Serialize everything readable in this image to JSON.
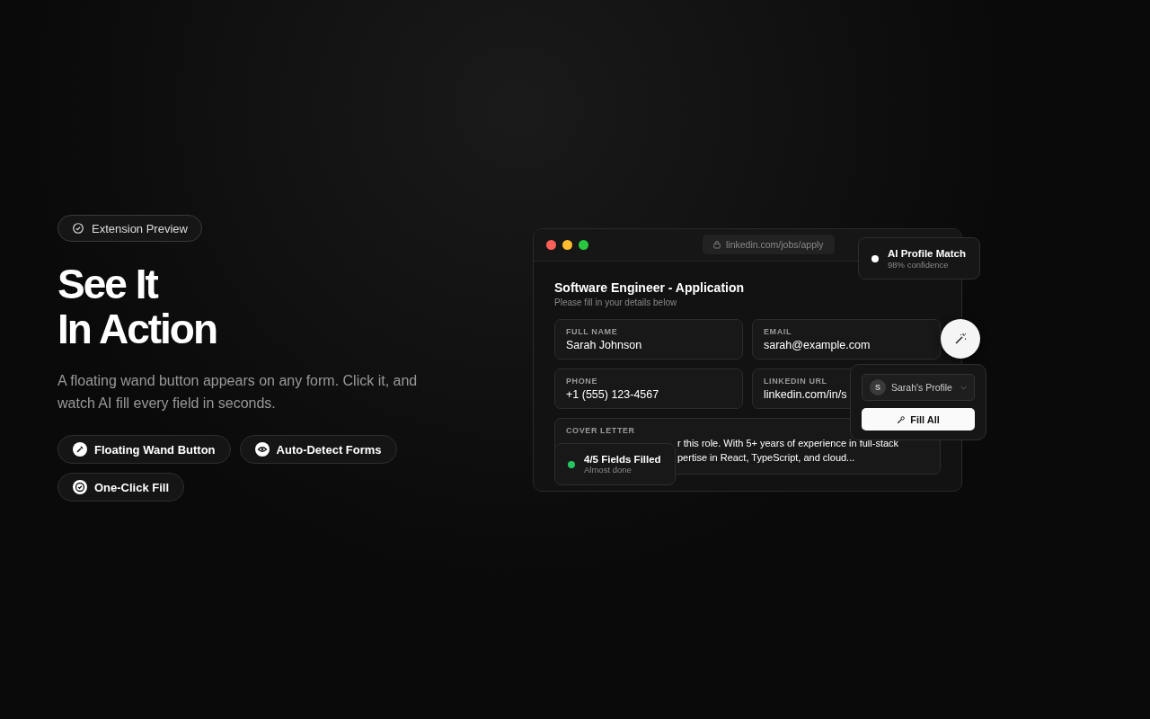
{
  "badge": {
    "label": "Extension Preview"
  },
  "heading": [
    "See It",
    "In Action"
  ],
  "description": "A floating wand button appears on any form. Click it, and watch AI fill every field in seconds.",
  "features": [
    {
      "kind": "wand",
      "label": "Floating Wand Button"
    },
    {
      "kind": "eye",
      "label": "Auto-Detect Forms"
    },
    {
      "kind": "check",
      "label": "One-Click Fill"
    }
  ],
  "browser": {
    "url": "linkedin.com/jobs/apply",
    "form_title": "Software Engineer - Application",
    "form_subtitle": "Please fill in your details below",
    "fields": [
      {
        "label": "FULL NAME",
        "value": "Sarah Johnson"
      },
      {
        "label": "EMAIL",
        "value": "sarah@example.com"
      },
      {
        "label": "PHONE",
        "value": "+1 (555) 123-4567"
      },
      {
        "label": "LINKEDIN URL",
        "value": "linkedin.com/in/s"
      }
    ],
    "cover_letter": {
      "label": "COVER LETTER",
      "lines": [
        "r this role. With 5+ years of experience in full-stack",
        "pertise in React, TypeScript, and cloud..."
      ]
    }
  },
  "match_card": {
    "title": "AI Profile Match",
    "subtitle": "98% confidence"
  },
  "fill_popup": {
    "avatar": "S",
    "profile": "Sarah's Profile",
    "button": "Fill All"
  },
  "progress_toast": {
    "title": "4/5 Fields Filled",
    "subtitle": "Almost done",
    "color": "#22c55e"
  }
}
